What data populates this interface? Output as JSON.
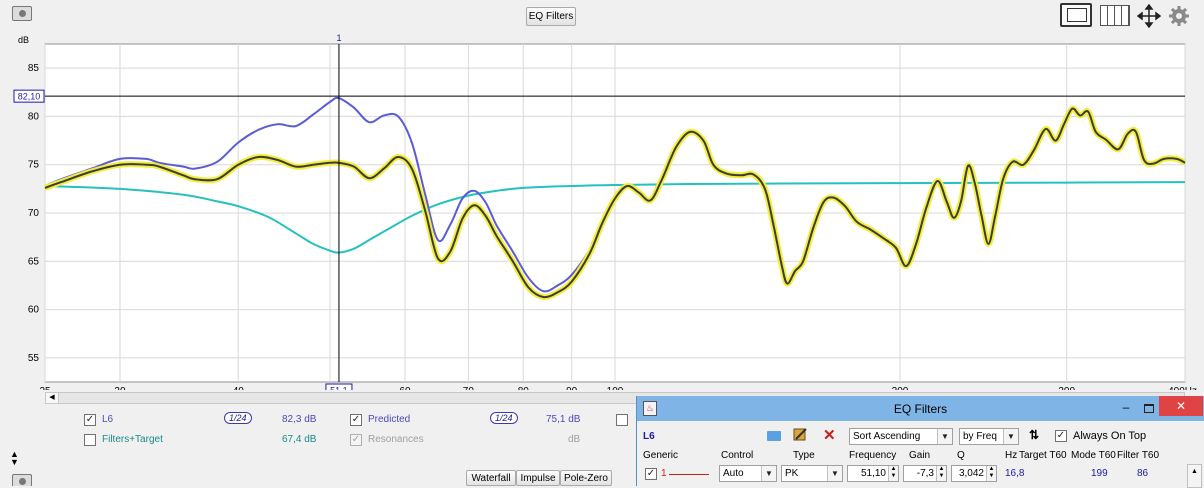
{
  "toolbar": {
    "eq_filters_button": "EQ Filters"
  },
  "graph": {
    "cursor_label": "1",
    "cursor_value_box": "82,10",
    "cursor_freq_box": "51,1"
  },
  "chart_data": {
    "type": "line",
    "ylabel": "dB",
    "x_scale": "log",
    "xlim": [
      25,
      400
    ],
    "ylim": [
      52.5,
      87.5
    ],
    "y_ticks": [
      55,
      60,
      65,
      70,
      75,
      80,
      85
    ],
    "x_tick_labels": [
      {
        "value": 25,
        "label": "25"
      },
      {
        "value": 30,
        "label": "30"
      },
      {
        "value": 40,
        "label": "40"
      },
      {
        "value": 60,
        "label": "60"
      },
      {
        "value": 70,
        "label": "70"
      },
      {
        "value": 80,
        "label": "80"
      },
      {
        "value": 90,
        "label": "90"
      },
      {
        "value": 100,
        "label": "100"
      },
      {
        "value": 200,
        "label": "200"
      },
      {
        "value": 300,
        "label": "300"
      },
      {
        "value": 400,
        "label": "400Hz"
      }
    ],
    "cursor": {
      "x": 51.1,
      "y": 82.1
    },
    "colors": {
      "L6": "#5b5bd6",
      "Predicted": "#3c3c3c",
      "Predicted_highlight": "#f3ee3a",
      "Filters+Target": "#27c0c0",
      "grid": "#d8d8d8",
      "cursor": "#000000"
    },
    "series": [
      {
        "name": "L6",
        "points": [
          [
            25,
            72.8
          ],
          [
            26,
            73.5
          ],
          [
            28,
            74.6
          ],
          [
            30,
            75.6
          ],
          [
            32,
            75.6
          ],
          [
            33,
            75.2
          ],
          [
            35,
            74.8
          ],
          [
            36,
            74.6
          ],
          [
            38,
            75.3
          ],
          [
            40,
            77.3
          ],
          [
            42,
            78.6
          ],
          [
            44,
            79.2
          ],
          [
            46,
            79.0
          ],
          [
            48,
            80.2
          ],
          [
            50,
            81.5
          ],
          [
            51.1,
            81.9
          ],
          [
            53,
            80.9
          ],
          [
            55,
            79.4
          ],
          [
            57,
            80.1
          ],
          [
            59,
            80.0
          ],
          [
            61,
            77.3
          ],
          [
            63,
            72.0
          ],
          [
            65,
            67.2
          ],
          [
            67,
            68.8
          ],
          [
            69,
            71.5
          ],
          [
            71,
            72.3
          ],
          [
            73,
            71.1
          ],
          [
            75,
            68.7
          ],
          [
            78,
            66.0
          ],
          [
            81,
            63.3
          ],
          [
            84,
            61.9
          ],
          [
            87,
            62.5
          ],
          [
            90,
            63.6
          ],
          [
            94,
            66.2
          ],
          [
            97,
            69.2
          ],
          [
            100,
            71.5
          ],
          [
            103,
            72.8
          ],
          [
            106,
            72.1
          ],
          [
            109,
            71.3
          ],
          [
            112,
            73.4
          ],
          [
            116,
            76.8
          ],
          [
            120,
            78.4
          ],
          [
            124,
            77.5
          ],
          [
            127,
            75.0
          ],
          [
            131,
            74.1
          ],
          [
            136,
            73.9
          ],
          [
            140,
            74.0
          ],
          [
            144,
            72.5
          ],
          [
            147,
            68.8
          ],
          [
            150,
            64.6
          ],
          [
            152,
            62.7
          ],
          [
            155,
            64.0
          ],
          [
            158,
            65.0
          ],
          [
            162,
            68.5
          ],
          [
            166,
            71.1
          ],
          [
            170,
            71.6
          ],
          [
            175,
            70.7
          ],
          [
            180,
            69.1
          ],
          [
            186,
            68.3
          ],
          [
            192,
            67.4
          ],
          [
            198,
            66.4
          ],
          [
            203,
            64.5
          ],
          [
            208,
            66.8
          ],
          [
            213,
            70.4
          ],
          [
            219,
            73.3
          ],
          [
            224,
            71.2
          ],
          [
            228,
            69.5
          ],
          [
            232,
            71.2
          ],
          [
            236,
            74.9
          ],
          [
            240,
            73.0
          ],
          [
            244,
            69.6
          ],
          [
            248,
            66.8
          ],
          [
            252,
            69.6
          ],
          [
            257,
            73.5
          ],
          [
            263,
            75.3
          ],
          [
            270,
            75.0
          ],
          [
            277,
            76.5
          ],
          [
            285,
            78.7
          ],
          [
            292,
            77.5
          ],
          [
            298,
            79.2
          ],
          [
            304,
            80.8
          ],
          [
            310,
            80.1
          ],
          [
            316,
            80.5
          ],
          [
            322,
            78.4
          ],
          [
            330,
            77.6
          ],
          [
            340,
            76.6
          ],
          [
            348,
            78.2
          ],
          [
            355,
            78.4
          ],
          [
            362,
            75.5
          ],
          [
            370,
            75.1
          ],
          [
            380,
            75.6
          ],
          [
            392,
            75.6
          ],
          [
            400,
            75.2
          ]
        ]
      },
      {
        "name": "Predicted",
        "points": [
          [
            25,
            72.6
          ],
          [
            26,
            73.2
          ],
          [
            28,
            74.3
          ],
          [
            30,
            75.0
          ],
          [
            32,
            75.0
          ],
          [
            33,
            74.8
          ],
          [
            35,
            73.9
          ],
          [
            36,
            73.5
          ],
          [
            38,
            73.5
          ],
          [
            40,
            75.0
          ],
          [
            42,
            75.8
          ],
          [
            44,
            75.5
          ],
          [
            46,
            74.8
          ],
          [
            48,
            75.0
          ],
          [
            50,
            75.2
          ],
          [
            51.1,
            75.2
          ],
          [
            53,
            74.8
          ],
          [
            55,
            73.6
          ],
          [
            57,
            74.6
          ],
          [
            59,
            75.8
          ],
          [
            61,
            74.6
          ],
          [
            63,
            70.3
          ],
          [
            65,
            65.3
          ],
          [
            67,
            66.0
          ],
          [
            69,
            69.4
          ],
          [
            71,
            70.8
          ],
          [
            73,
            69.7
          ],
          [
            75,
            67.6
          ],
          [
            78,
            65.0
          ],
          [
            81,
            62.3
          ],
          [
            84,
            61.3
          ],
          [
            87,
            61.8
          ],
          [
            90,
            62.9
          ],
          [
            94,
            65.8
          ],
          [
            97,
            69.0
          ],
          [
            100,
            71.5
          ],
          [
            103,
            72.8
          ],
          [
            106,
            72.1
          ],
          [
            109,
            71.3
          ],
          [
            112,
            73.4
          ],
          [
            116,
            76.8
          ],
          [
            120,
            78.4
          ],
          [
            124,
            77.5
          ],
          [
            127,
            75.0
          ],
          [
            131,
            74.1
          ],
          [
            136,
            73.9
          ],
          [
            140,
            74.0
          ],
          [
            144,
            72.5
          ],
          [
            147,
            68.8
          ],
          [
            150,
            64.6
          ],
          [
            152,
            62.7
          ],
          [
            155,
            64.0
          ],
          [
            158,
            65.0
          ],
          [
            162,
            68.5
          ],
          [
            166,
            71.1
          ],
          [
            170,
            71.6
          ],
          [
            175,
            70.7
          ],
          [
            180,
            69.1
          ],
          [
            186,
            68.3
          ],
          [
            192,
            67.4
          ],
          [
            198,
            66.4
          ],
          [
            203,
            64.5
          ],
          [
            208,
            66.8
          ],
          [
            213,
            70.4
          ],
          [
            219,
            73.3
          ],
          [
            224,
            71.2
          ],
          [
            228,
            69.5
          ],
          [
            232,
            71.2
          ],
          [
            236,
            74.9
          ],
          [
            240,
            73.0
          ],
          [
            244,
            69.6
          ],
          [
            248,
            66.8
          ],
          [
            252,
            69.6
          ],
          [
            257,
            73.5
          ],
          [
            263,
            75.3
          ],
          [
            270,
            75.0
          ],
          [
            277,
            76.5
          ],
          [
            285,
            78.7
          ],
          [
            292,
            77.5
          ],
          [
            298,
            79.2
          ],
          [
            304,
            80.8
          ],
          [
            310,
            80.1
          ],
          [
            316,
            80.5
          ],
          [
            322,
            78.4
          ],
          [
            330,
            77.6
          ],
          [
            340,
            76.6
          ],
          [
            348,
            78.2
          ],
          [
            355,
            78.4
          ],
          [
            362,
            75.5
          ],
          [
            370,
            75.1
          ],
          [
            380,
            75.6
          ],
          [
            392,
            75.6
          ],
          [
            400,
            75.2
          ]
        ]
      },
      {
        "name": "Filters+Target",
        "points": [
          [
            25,
            72.8
          ],
          [
            30,
            72.5
          ],
          [
            35,
            71.9
          ],
          [
            38,
            71.2
          ],
          [
            40,
            70.7
          ],
          [
            43,
            69.6
          ],
          [
            46,
            67.9
          ],
          [
            48,
            66.8
          ],
          [
            50,
            66.1
          ],
          [
            51.1,
            65.9
          ],
          [
            53,
            66.3
          ],
          [
            55,
            67.2
          ],
          [
            58,
            68.5
          ],
          [
            61,
            69.7
          ],
          [
            65,
            70.9
          ],
          [
            70,
            71.8
          ],
          [
            75,
            72.3
          ],
          [
            80,
            72.6
          ],
          [
            90,
            72.8
          ],
          [
            100,
            72.9
          ],
          [
            120,
            73.0
          ],
          [
            150,
            73.05
          ],
          [
            200,
            73.1
          ],
          [
            300,
            73.15
          ],
          [
            400,
            73.2
          ]
        ]
      }
    ]
  },
  "legend": {
    "l6": {
      "label": "L6",
      "smoothing": "1/24",
      "value": "82,3 dB",
      "checked": "✓"
    },
    "predicted": {
      "label": "Predicted",
      "smoothing": "1/24",
      "value": "75,1 dB",
      "checked": "✓"
    },
    "filters_target": {
      "label": "Filters+Target",
      "value": "67,4 dB"
    },
    "resonances": {
      "label": "Resonances",
      "value": "dB",
      "checked": "✓"
    }
  },
  "bottom_tabs": [
    "Waterfall",
    "Impulse",
    "Pole-Zero"
  ],
  "eq_window": {
    "title": "EQ Filters",
    "measurement": "L6",
    "sort_select": "Sort Ascending",
    "sort_by_select": "by Freq",
    "always_on_top": "Always On Top",
    "always_on_top_checked": "✓",
    "headers": {
      "generic": "Generic",
      "control": "Control",
      "type": "Type",
      "frequency": "Frequency",
      "gain": "Gain",
      "q": "Q",
      "hz": "Hz",
      "target_t60": "Target T60",
      "mode_t60": "Mode T60",
      "filter_t60": "Filter T60"
    },
    "filter_row": {
      "checked": "✓",
      "number": "1",
      "control": "Auto",
      "type": "PK",
      "frequency": "51,10",
      "gain": "-7,3",
      "q": "3,042",
      "hz": "16,8",
      "mode_t60": "199",
      "filter_t60": "86"
    },
    "colors": {
      "titlebar": "#7fb4e6",
      "close": "#e04343",
      "value_text": "#1a1aa8"
    }
  }
}
